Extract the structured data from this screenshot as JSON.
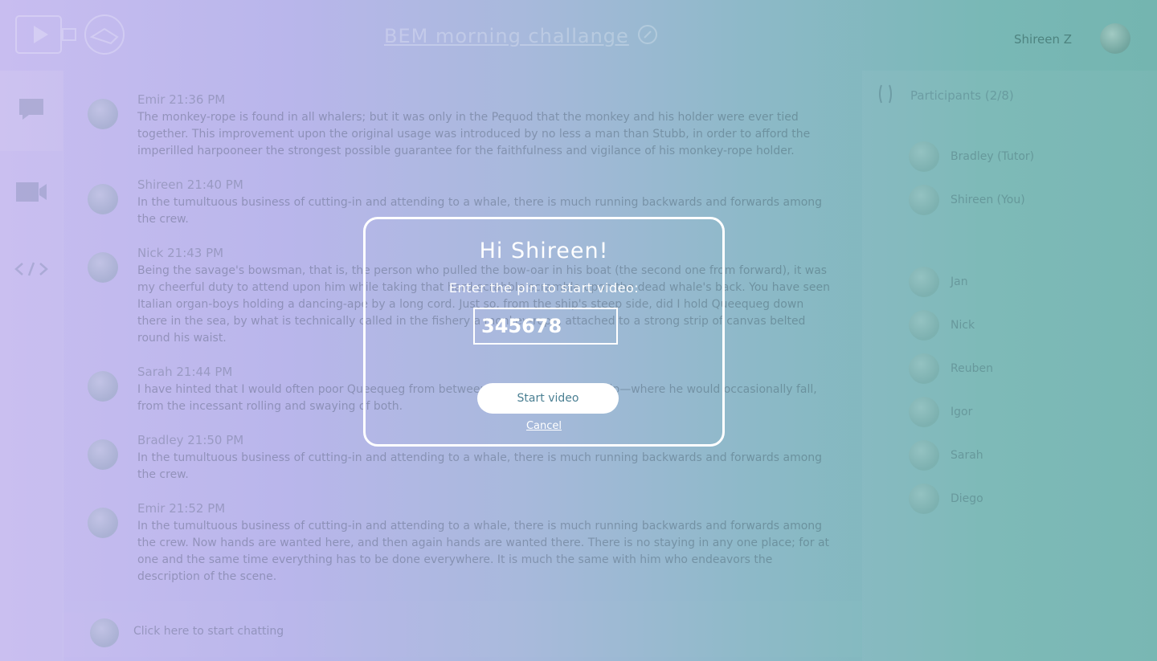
{
  "header": {
    "title": "BEM morning challange",
    "user_name": "Shireen Z"
  },
  "icons": {
    "logo": "video-play-logo",
    "edit": "pencil-icon",
    "chat": "chat-bubble-icon",
    "video": "video-camera-icon",
    "code": "code-icon",
    "collapse": "panel-toggle-icon"
  },
  "messages": [
    {
      "author": "Emir",
      "time": "21:36 PM",
      "text": "The monkey-rope is found in all whalers; but it was only in the Pequod that the monkey and his holder were ever tied together. This improvement upon the original usage was introduced by no less a man than Stubb, in order to afford the imperilled harpooneer the strongest possible guarantee for the faithfulness and vigilance of his monkey-rope holder."
    },
    {
      "author": "Shireen",
      "time": "21:40 PM",
      "text": "In the tumultuous business of cutting-in and attending to a whale, there is much running backwards and forwards among the crew."
    },
    {
      "author": "Nick",
      "time": "21:43 PM",
      "text": "Being the savage's bowsman, that is, the person who pulled the bow-oar in his boat (the second one from forward), it was my cheerful duty to attend upon him while taking that hard-scrabble scramble upon the dead whale's back. You have seen Italian organ-boys holding a dancing-ape by a long cord. Just so, from the ship's steep side, did I hold Queequeg down there in the sea, by what is technically called in the fishery a monkey-rope, attached to a strong strip of canvas belted round his waist."
    },
    {
      "author": "Sarah",
      "time": "21:44 PM",
      "text": "I have hinted that I would often poor Queequeg from between the whale and the ship—where he would occasionally fall, from the incessant rolling and swaying of both."
    },
    {
      "author": "Bradley",
      "time": "21:50 PM",
      "text": "In the tumultuous business of cutting-in and attending to a whale, there is much running backwards and forwards among the crew."
    },
    {
      "author": "Emir",
      "time": "21:52 PM",
      "text": "In the tumultuous business of cutting-in and attending to a whale, there is much running backwards and forwards among the crew. Now hands are wanted here, and then again hands are wanted there. There is no staying in any one place; for at one and the same time everything has to be done everywhere. It is much the same with him who endeavors the description of the scene."
    }
  ],
  "composer": {
    "placeholder": "Click here to start chatting"
  },
  "participants": {
    "header": "Participants (2/8)",
    "online": [
      "Bradley (Tutor)",
      "Shireen (You)"
    ],
    "offline": [
      "Jan",
      "Nick",
      "Reuben",
      "Igor",
      "Sarah",
      "Diego"
    ]
  },
  "modal": {
    "greeting": "Hi Shireen!",
    "prompt": "Enter the pin to start video:",
    "pin_value": "345678",
    "start_label": "Start video",
    "cancel_label": "Cancel"
  }
}
